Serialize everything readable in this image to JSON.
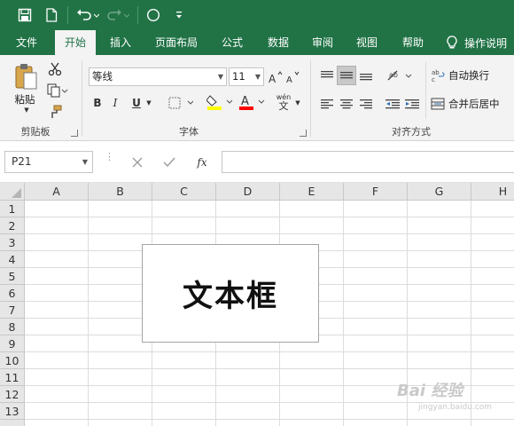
{
  "qat": {
    "save_icon": "save-icon",
    "new_icon": "new-document-icon",
    "undo_icon": "undo-icon",
    "redo_icon": "redo-icon",
    "shape_icon": "circle-shape-icon",
    "customize_icon": "customize-qat-icon"
  },
  "tabs": [
    "文件",
    "开始",
    "插入",
    "页面布局",
    "公式",
    "数据",
    "审阅",
    "视图",
    "帮助"
  ],
  "active_tab": "开始",
  "tell_me": "操作说明",
  "clipboard": {
    "paste_label": "粘贴",
    "group_label": "剪贴板"
  },
  "font": {
    "font_name": "等线",
    "font_size": "11",
    "bold": "B",
    "italic": "I",
    "underline": "U",
    "group_label": "字体",
    "phonetic_top": "wén",
    "phonetic_bottom": "文"
  },
  "alignment": {
    "wrap_text": "自动换行",
    "merge_center": "合并后居中",
    "group_label": "对齐方式"
  },
  "formula_bar": {
    "name_box": "P21",
    "cancel_icon": "cancel-icon",
    "enter_icon": "check-icon",
    "fx_label": "fx",
    "formula": ""
  },
  "sheet": {
    "columns": [
      "A",
      "B",
      "C",
      "D",
      "E",
      "F",
      "G",
      "H"
    ],
    "rows": [
      "1",
      "2",
      "3",
      "4",
      "5",
      "6",
      "7",
      "8",
      "9",
      "10",
      "11",
      "12",
      "13"
    ],
    "textbox_text": "文本框"
  },
  "watermark": {
    "text": "Bai 经验",
    "sub": "jingyan.baidu.com"
  },
  "colors": {
    "excel_green": "#217346",
    "highlight_yellow": "#ffff00",
    "font_red": "#ff0000"
  }
}
